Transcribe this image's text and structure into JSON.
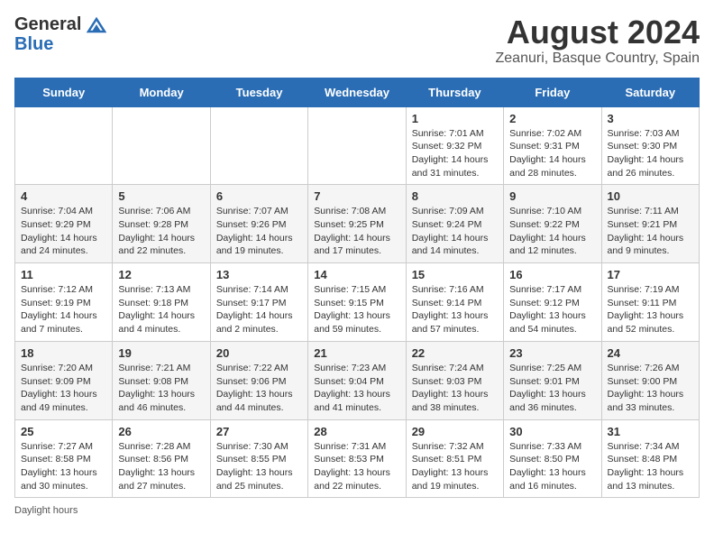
{
  "header": {
    "logo_general": "General",
    "logo_blue": "Blue",
    "month_title": "August 2024",
    "subtitle": "Zeanuri, Basque Country, Spain"
  },
  "days_of_week": [
    "Sunday",
    "Monday",
    "Tuesday",
    "Wednesday",
    "Thursday",
    "Friday",
    "Saturday"
  ],
  "weeks": [
    [
      {
        "num": "",
        "info": ""
      },
      {
        "num": "",
        "info": ""
      },
      {
        "num": "",
        "info": ""
      },
      {
        "num": "",
        "info": ""
      },
      {
        "num": "1",
        "info": "Sunrise: 7:01 AM\nSunset: 9:32 PM\nDaylight: 14 hours and 31 minutes."
      },
      {
        "num": "2",
        "info": "Sunrise: 7:02 AM\nSunset: 9:31 PM\nDaylight: 14 hours and 28 minutes."
      },
      {
        "num": "3",
        "info": "Sunrise: 7:03 AM\nSunset: 9:30 PM\nDaylight: 14 hours and 26 minutes."
      }
    ],
    [
      {
        "num": "4",
        "info": "Sunrise: 7:04 AM\nSunset: 9:29 PM\nDaylight: 14 hours and 24 minutes."
      },
      {
        "num": "5",
        "info": "Sunrise: 7:06 AM\nSunset: 9:28 PM\nDaylight: 14 hours and 22 minutes."
      },
      {
        "num": "6",
        "info": "Sunrise: 7:07 AM\nSunset: 9:26 PM\nDaylight: 14 hours and 19 minutes."
      },
      {
        "num": "7",
        "info": "Sunrise: 7:08 AM\nSunset: 9:25 PM\nDaylight: 14 hours and 17 minutes."
      },
      {
        "num": "8",
        "info": "Sunrise: 7:09 AM\nSunset: 9:24 PM\nDaylight: 14 hours and 14 minutes."
      },
      {
        "num": "9",
        "info": "Sunrise: 7:10 AM\nSunset: 9:22 PM\nDaylight: 14 hours and 12 minutes."
      },
      {
        "num": "10",
        "info": "Sunrise: 7:11 AM\nSunset: 9:21 PM\nDaylight: 14 hours and 9 minutes."
      }
    ],
    [
      {
        "num": "11",
        "info": "Sunrise: 7:12 AM\nSunset: 9:19 PM\nDaylight: 14 hours and 7 minutes."
      },
      {
        "num": "12",
        "info": "Sunrise: 7:13 AM\nSunset: 9:18 PM\nDaylight: 14 hours and 4 minutes."
      },
      {
        "num": "13",
        "info": "Sunrise: 7:14 AM\nSunset: 9:17 PM\nDaylight: 14 hours and 2 minutes."
      },
      {
        "num": "14",
        "info": "Sunrise: 7:15 AM\nSunset: 9:15 PM\nDaylight: 13 hours and 59 minutes."
      },
      {
        "num": "15",
        "info": "Sunrise: 7:16 AM\nSunset: 9:14 PM\nDaylight: 13 hours and 57 minutes."
      },
      {
        "num": "16",
        "info": "Sunrise: 7:17 AM\nSunset: 9:12 PM\nDaylight: 13 hours and 54 minutes."
      },
      {
        "num": "17",
        "info": "Sunrise: 7:19 AM\nSunset: 9:11 PM\nDaylight: 13 hours and 52 minutes."
      }
    ],
    [
      {
        "num": "18",
        "info": "Sunrise: 7:20 AM\nSunset: 9:09 PM\nDaylight: 13 hours and 49 minutes."
      },
      {
        "num": "19",
        "info": "Sunrise: 7:21 AM\nSunset: 9:08 PM\nDaylight: 13 hours and 46 minutes."
      },
      {
        "num": "20",
        "info": "Sunrise: 7:22 AM\nSunset: 9:06 PM\nDaylight: 13 hours and 44 minutes."
      },
      {
        "num": "21",
        "info": "Sunrise: 7:23 AM\nSunset: 9:04 PM\nDaylight: 13 hours and 41 minutes."
      },
      {
        "num": "22",
        "info": "Sunrise: 7:24 AM\nSunset: 9:03 PM\nDaylight: 13 hours and 38 minutes."
      },
      {
        "num": "23",
        "info": "Sunrise: 7:25 AM\nSunset: 9:01 PM\nDaylight: 13 hours and 36 minutes."
      },
      {
        "num": "24",
        "info": "Sunrise: 7:26 AM\nSunset: 9:00 PM\nDaylight: 13 hours and 33 minutes."
      }
    ],
    [
      {
        "num": "25",
        "info": "Sunrise: 7:27 AM\nSunset: 8:58 PM\nDaylight: 13 hours and 30 minutes."
      },
      {
        "num": "26",
        "info": "Sunrise: 7:28 AM\nSunset: 8:56 PM\nDaylight: 13 hours and 27 minutes."
      },
      {
        "num": "27",
        "info": "Sunrise: 7:30 AM\nSunset: 8:55 PM\nDaylight: 13 hours and 25 minutes."
      },
      {
        "num": "28",
        "info": "Sunrise: 7:31 AM\nSunset: 8:53 PM\nDaylight: 13 hours and 22 minutes."
      },
      {
        "num": "29",
        "info": "Sunrise: 7:32 AM\nSunset: 8:51 PM\nDaylight: 13 hours and 19 minutes."
      },
      {
        "num": "30",
        "info": "Sunrise: 7:33 AM\nSunset: 8:50 PM\nDaylight: 13 hours and 16 minutes."
      },
      {
        "num": "31",
        "info": "Sunrise: 7:34 AM\nSunset: 8:48 PM\nDaylight: 13 hours and 13 minutes."
      }
    ]
  ],
  "footer": {
    "daylight_label": "Daylight hours"
  }
}
